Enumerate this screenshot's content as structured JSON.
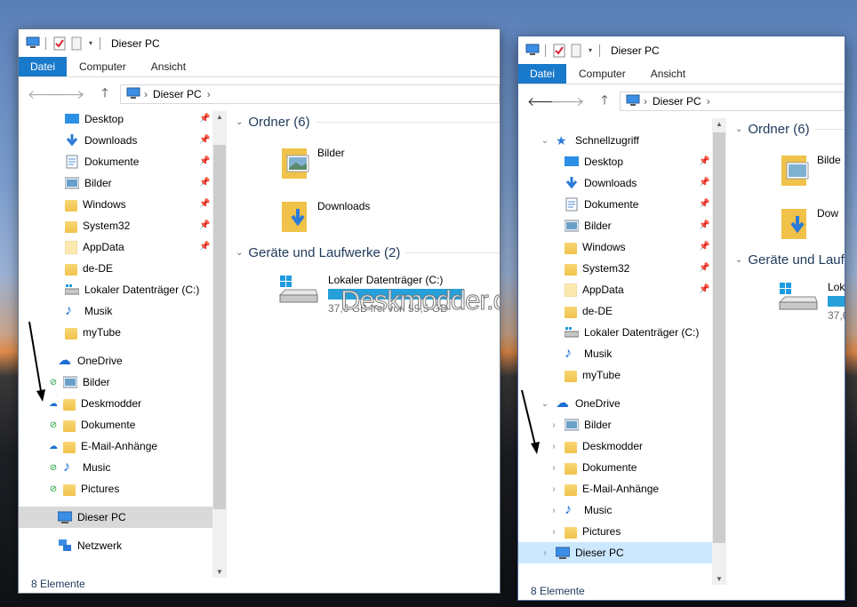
{
  "watermark": "Deskmodder.de",
  "left": {
    "title": "Dieser PC",
    "tabs": [
      "Datei",
      "Computer",
      "Ansicht"
    ],
    "address": "Dieser PC",
    "nav": [
      {
        "label": "Desktop",
        "icon": "desktop-icon",
        "pin": true
      },
      {
        "label": "Downloads",
        "icon": "downloads-icon",
        "pin": true
      },
      {
        "label": "Dokumente",
        "icon": "documents-icon",
        "pin": true
      },
      {
        "label": "Bilder",
        "icon": "pictures-icon",
        "pin": true
      },
      {
        "label": "Windows",
        "icon": "folder-icon",
        "pin": true
      },
      {
        "label": "System32",
        "icon": "folder-icon",
        "pin": true
      },
      {
        "label": "AppData",
        "icon": "folder-icon",
        "pin": true
      },
      {
        "label": "de-DE",
        "icon": "folder-icon",
        "pin": false
      },
      {
        "label": "Lokaler Datenträger (C:)",
        "icon": "drive-icon",
        "pin": false
      },
      {
        "label": "Musik",
        "icon": "music-icon",
        "pin": false
      },
      {
        "label": "myTube",
        "icon": "folder-icon",
        "pin": false
      }
    ],
    "onedrive": "OneDrive",
    "onedrive_items": [
      {
        "label": "Bilder",
        "status": "synced"
      },
      {
        "label": "Deskmodder",
        "status": "cloud"
      },
      {
        "label": "Dokumente",
        "status": "synced"
      },
      {
        "label": "E-Mail-Anhänge",
        "status": "cloud"
      },
      {
        "label": "Music",
        "status": "synced"
      },
      {
        "label": "Pictures",
        "status": "synced"
      }
    ],
    "thispc": "Dieser PC",
    "network": "Netzwerk",
    "group_folders": "Ordner (6)",
    "folders": [
      "Bilder",
      "Downloads"
    ],
    "group_drives": "Geräte und Laufwerke (2)",
    "drive_name": "Lokaler Datenträger (C:)",
    "drive_free": "37,6 GB frei von 59,5 GB",
    "drive_used_fraction": 0.37,
    "status": "8 Elemente"
  },
  "right": {
    "title": "Dieser PC",
    "tabs": [
      "Datei",
      "Computer",
      "Ansicht"
    ],
    "address": "Dieser PC",
    "quickaccess": "Schnellzugriff",
    "nav": [
      {
        "label": "Desktop",
        "pin": true
      },
      {
        "label": "Downloads",
        "pin": true
      },
      {
        "label": "Dokumente",
        "pin": true
      },
      {
        "label": "Bilder",
        "pin": true
      },
      {
        "label": "Windows",
        "pin": true
      },
      {
        "label": "System32",
        "pin": true
      },
      {
        "label": "AppData",
        "pin": true
      },
      {
        "label": "de-DE",
        "pin": false
      },
      {
        "label": "Lokaler Datenträger (C:)",
        "pin": false
      },
      {
        "label": "Musik",
        "pin": false
      },
      {
        "label": "myTube",
        "pin": false
      }
    ],
    "onedrive": "OneDrive",
    "onedrive_items": [
      "Bilder",
      "Deskmodder",
      "Dokumente",
      "E-Mail-Anhänge",
      "Music",
      "Pictures"
    ],
    "thispc": "Dieser PC",
    "group_folders": "Ordner (6)",
    "folders": [
      "Bilde",
      "Dow"
    ],
    "group_drives": "Geräte und Laufw",
    "drive_name": "Loka",
    "drive_free": "37,6",
    "status": "8 Elemente"
  }
}
